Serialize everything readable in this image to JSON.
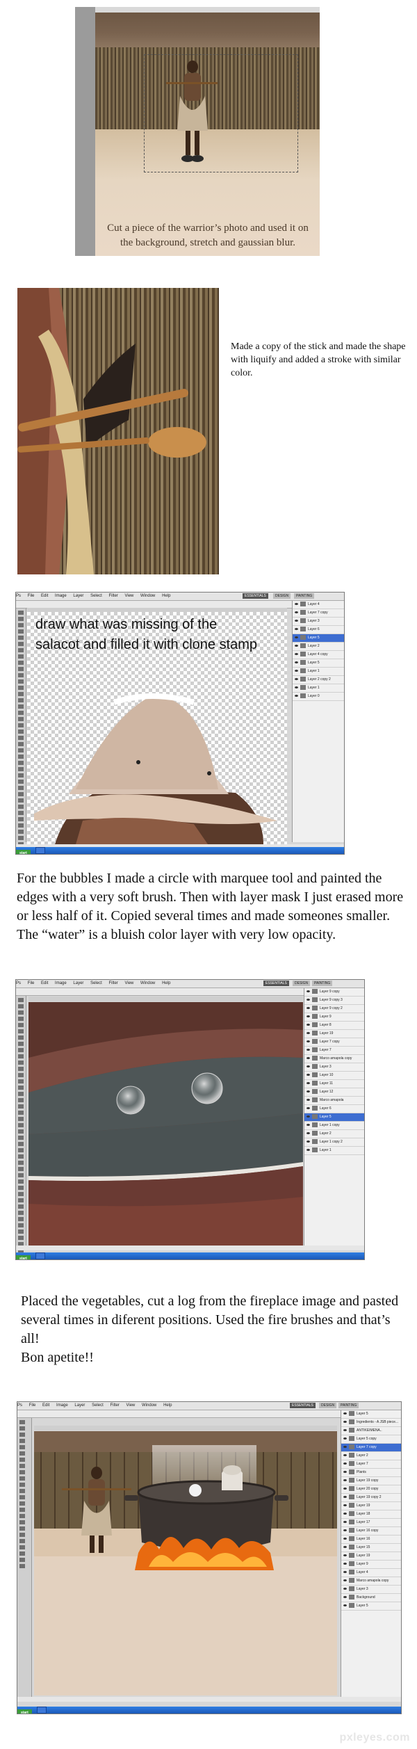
{
  "steps": {
    "step1": {
      "caption": "Cut a piece of the warrior’s photo and used it on the background, stretch and gaussian blur."
    },
    "step2": {
      "text": "Made a copy of the stick and made the shape with liquify and added a stroke with similar color."
    },
    "step3": {
      "canvas_text": "draw what was missing of the salacot and filled it with clone stamp"
    },
    "step4": {
      "text_line1": "For the bubbles I made a circle with marquee tool and painted the edges with a very soft brush. Then with layer mask I just erased more or less half of it. Copied several times and made someones smaller.",
      "text_line2": "The “water” is a bluish color layer  with very low opacity."
    },
    "step5": {
      "text_line1": "Placed the vegetables, cut a log from the fireplace image and pasted several times in diferent positions. Used the fire brushes and that’s all!",
      "text_line2": "Bon apetite!!"
    }
  },
  "photoshop": {
    "menus": [
      "Ps",
      "File",
      "Edit",
      "Image",
      "Layer",
      "Select",
      "Filter",
      "View",
      "Window",
      "Help"
    ],
    "workspaces": [
      "ESSENTIALS",
      "DESIGN",
      "PAINTING"
    ],
    "start_label": "start",
    "layers_step3": [
      "Layer 4",
      "Layer 7 copy",
      "Layer 3",
      "Layer 6",
      "Layer 5",
      "Layer 2",
      "Layer 4 copy",
      "Layer 5",
      "Layer 1",
      "Layer 2 copy 2",
      "Layer 1",
      "Layer 0"
    ],
    "layers_step4": [
      "Layer 9 copy",
      "Layer 9 copy 3",
      "Layer 9 copy 2",
      "Layer 9",
      "Layer 8",
      "Layer 19",
      "Layer 7 copy",
      "Layer 7",
      "Marco amapola copy",
      "Layer 3",
      "Layer 10",
      "Layer 11",
      "Layer 12",
      "Marco amapola",
      "Layer 6",
      "Layer 5",
      "Layer 1 copy",
      "Layer 2",
      "Layer 1 copy 2",
      "Layer 1"
    ],
    "layers_step6": [
      "Layer 5",
      "Ingredients - A JSB piece...",
      "ΑΝΤΙΚΕΙΜΕΝΑ..",
      "Layer 5 copy",
      "Layer 7 copy",
      "Layer 2",
      "Layer 7",
      "Plants",
      "Layer 19 copy",
      "Layer 20 copy",
      "Layer 19 copy 2",
      "Layer 19",
      "Layer 18",
      "Layer 17",
      "Layer 16 copy",
      "Layer 16",
      "Layer 15",
      "Layer 19",
      "Layer 9",
      "Layer 4",
      "Marco amapola copy",
      "Layer 3",
      "Background",
      "Layer 5"
    ]
  },
  "watermark": "pxleyes.com"
}
